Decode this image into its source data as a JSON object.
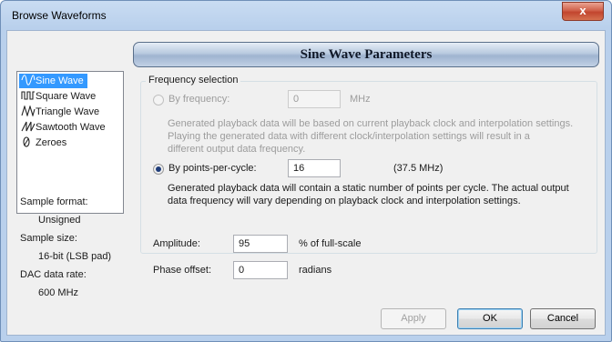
{
  "window": {
    "title": "Browse Waveforms",
    "close_glyph": "x"
  },
  "banner": {
    "title": "Sine Wave Parameters"
  },
  "waveforms": [
    {
      "label": "Sine Wave",
      "icon": "sine-wave-icon",
      "selected": true
    },
    {
      "label": "Square Wave",
      "icon": "square-wave-icon",
      "selected": false
    },
    {
      "label": "Triangle Wave",
      "icon": "triangle-wave-icon",
      "selected": false
    },
    {
      "label": "Sawtooth Wave",
      "icon": "sawtooth-wave-icon",
      "selected": false
    },
    {
      "label": "Zeroes",
      "icon": "zero-icon",
      "selected": false
    }
  ],
  "info": {
    "sample_format_label": "Sample format:",
    "sample_format_value": "Unsigned",
    "sample_size_label": "Sample size:",
    "sample_size_value": "16-bit (LSB pad)",
    "dac_rate_label": "DAC data rate:",
    "dac_rate_value": "600 MHz"
  },
  "frequency": {
    "legend": "Frequency selection",
    "by_frequency": {
      "label": "By frequency:",
      "value": "0",
      "unit": "MHz",
      "checked": false,
      "enabled": false,
      "description_lines": [
        "Generated playback data will be based on current playback clock and interpolation settings.",
        "Playing the generated data with different clock/interpolation settings will result in a",
        "different output data frequency."
      ]
    },
    "by_points": {
      "label": "By points-per-cycle:",
      "value": "16",
      "computed": "(37.5 MHz)",
      "checked": true,
      "description_lines": [
        "Generated playback data will contain a static number of points per cycle. The actual output",
        "data frequency will vary depending on playback clock and interpolation settings."
      ]
    }
  },
  "amplitude": {
    "label": "Amplitude:",
    "value": "95",
    "unit": "% of full-scale"
  },
  "phase": {
    "label": "Phase offset:",
    "value": "0",
    "unit": "radians"
  },
  "buttons": {
    "apply": "Apply",
    "ok": "OK",
    "cancel": "Cancel"
  },
  "colors": {
    "selection": "#3399ff",
    "close_button": "#c2452e",
    "title_gradient": "#b9d0ec"
  }
}
